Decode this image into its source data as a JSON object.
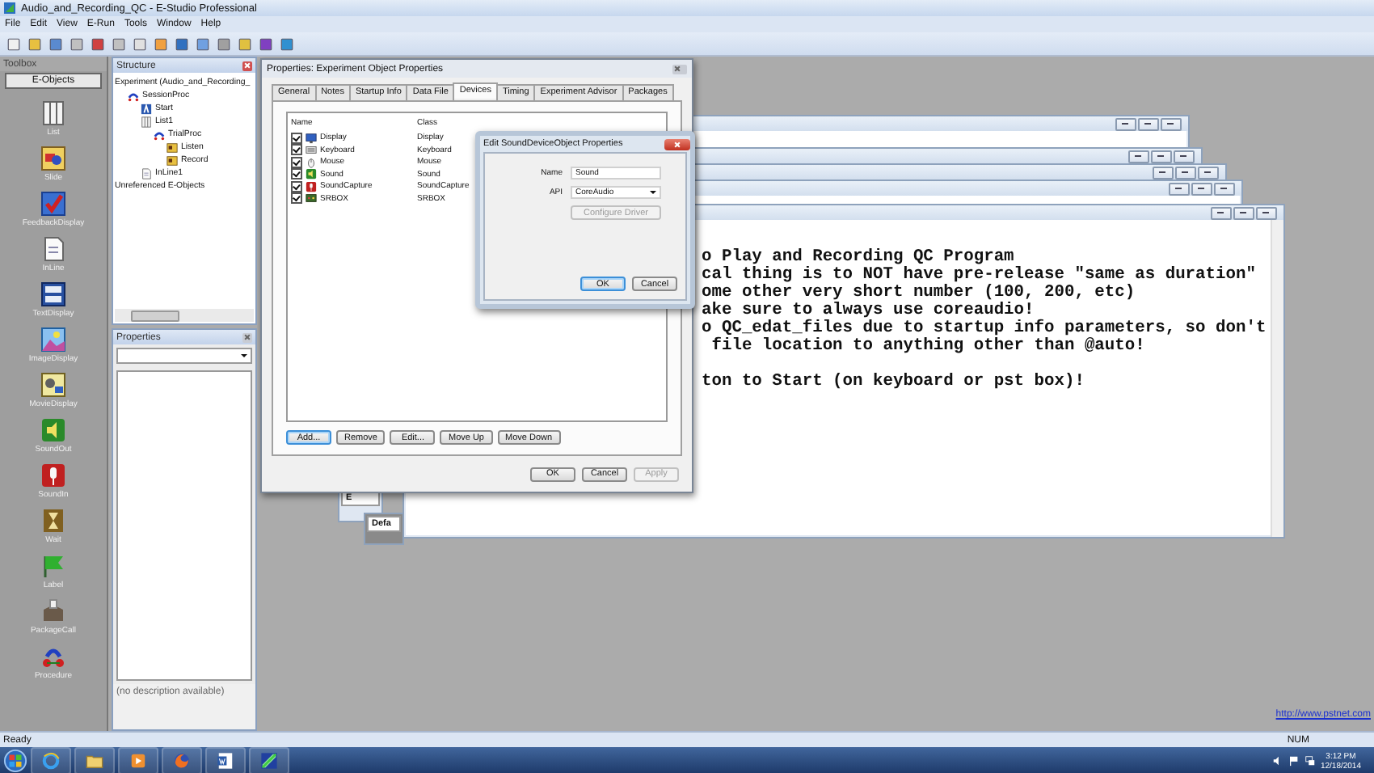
{
  "window": {
    "title": "Audio_and_Recording_QC - E-Studio Professional"
  },
  "menu": [
    "File",
    "Edit",
    "View",
    "E-Run",
    "Tools",
    "Window",
    "Help"
  ],
  "toolbox": {
    "title": "Toolbox",
    "category": "E-Objects",
    "items": [
      "List",
      "Slide",
      "FeedbackDisplay",
      "InLine",
      "TextDisplay",
      "ImageDisplay",
      "MovieDisplay",
      "SoundOut",
      "SoundIn",
      "Wait",
      "Label",
      "PackageCall",
      "Procedure"
    ]
  },
  "structure": {
    "title": "Structure",
    "tree": [
      {
        "label": "Experiment (Audio_and_Recording_",
        "children": [
          {
            "label": "SessionProc",
            "kind": "procedure",
            "children": [
              {
                "label": "Start",
                "kind": "text"
              },
              {
                "label": "List1",
                "kind": "list",
                "children": [
                  {
                    "label": "TrialProc",
                    "kind": "procedure",
                    "children": [
                      {
                        "label": "Listen",
                        "kind": "slide"
                      },
                      {
                        "label": "Record",
                        "kind": "slide"
                      }
                    ]
                  }
                ]
              },
              {
                "label": "InLine1",
                "kind": "inline"
              }
            ]
          }
        ]
      },
      {
        "label": "Unreferenced E-Objects"
      }
    ]
  },
  "properties_panel": {
    "title": "Properties",
    "description": "(no description available)"
  },
  "properties_dialog": {
    "title": "Properties: Experiment Object Properties",
    "tabs": [
      {
        "label": "General",
        "selected": false
      },
      {
        "label": "Notes",
        "selected": false
      },
      {
        "label": "Startup Info",
        "selected": false
      },
      {
        "label": "Data File",
        "selected": false
      },
      {
        "label": "Devices",
        "selected": true
      },
      {
        "label": "Timing",
        "selected": false
      },
      {
        "label": "Experiment Advisor",
        "selected": false
      },
      {
        "label": "Packages",
        "selected": false
      }
    ],
    "columns": [
      "Name",
      "Class"
    ],
    "devices": [
      {
        "name": "Display",
        "class": "Display",
        "checked": true
      },
      {
        "name": "Keyboard",
        "class": "Keyboard",
        "checked": true
      },
      {
        "name": "Mouse",
        "class": "Mouse",
        "checked": true
      },
      {
        "name": "Sound",
        "class": "Sound",
        "checked": true
      },
      {
        "name": "SoundCapture",
        "class": "SoundCapture",
        "checked": true
      },
      {
        "name": "SRBOX",
        "class": "SRBOX",
        "checked": true
      }
    ],
    "buttons": [
      {
        "label": "Add...",
        "focused": true
      },
      {
        "label": "Remove",
        "focused": false
      },
      {
        "label": "Edit...",
        "focused": false
      },
      {
        "label": "Move Up",
        "focused": false
      },
      {
        "label": "Move Down",
        "focused": false
      }
    ],
    "footer_buttons": [
      {
        "label": "OK",
        "disabled": false
      },
      {
        "label": "Cancel",
        "disabled": false
      },
      {
        "label": "Apply",
        "disabled": true
      }
    ]
  },
  "edit_dialog": {
    "title": "Edit SoundDeviceObject Properties",
    "fields": [
      {
        "label": "Name",
        "kind": "text",
        "value": "Sound"
      },
      {
        "label": "API",
        "kind": "select",
        "value": "CoreAudio"
      }
    ],
    "configure_button": {
      "label": "Configure Driver",
      "disabled": true
    },
    "buttons": [
      {
        "label": "OK",
        "default": true
      },
      {
        "label": "Cancel",
        "default": false
      }
    ]
  },
  "document": {
    "paragraphs": [
      [
        "o Play and Recording QC Program",
        "cal thing is to NOT have pre-release \"same as duration\"",
        "ome other very short number (100, 200, etc)",
        "ake sure to always use coreaudio!",
        "o QC_edat_files due to startup info parameters, so don't",
        " file location to anything other than @auto!"
      ],
      [
        "ton to Start (on keyboard or pst box)!"
      ]
    ]
  },
  "minimized_windows": [
    "E",
    "Defa"
  ],
  "link": "http://www.pstnet.com",
  "status_bar": {
    "text": "Ready",
    "indicator": "NUM"
  },
  "taskbar": {
    "time": "3:12 PM",
    "date": "12/18/2014"
  }
}
